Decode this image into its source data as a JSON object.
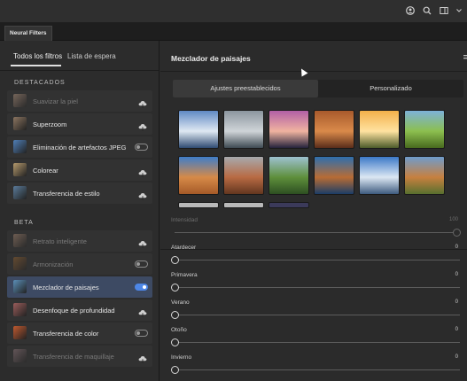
{
  "document_tab": "Neural Filters",
  "left_panel": {
    "tabs": [
      {
        "label": "Todos los filtros"
      },
      {
        "label": "Lista de espera"
      }
    ],
    "sections": [
      {
        "label": "DESTACADOS"
      },
      {
        "label": "BETA"
      }
    ],
    "items": [
      {
        "label": "Suavizar la piel",
        "control": "cloud",
        "dim": true,
        "thumb_color": "#c9a58b"
      },
      {
        "label": "Superzoom",
        "control": "cloud",
        "dim": false,
        "thumb_color": "#8c7560"
      },
      {
        "label": "Eliminación de artefactos JPEG",
        "control": "toggle",
        "toggle_on": false,
        "dim": false,
        "thumb_color": "#4f7fb8"
      },
      {
        "label": "Colorear",
        "control": "cloud",
        "dim": false,
        "thumb_color": "#b59a6d"
      },
      {
        "label": "Transferencia de estilo",
        "control": "cloud",
        "dim": false,
        "thumb_color": "#5a7b9a"
      },
      {
        "label": "Retrato inteligente",
        "control": "cloud",
        "dim": true,
        "thumb_color": "#b89279"
      },
      {
        "label": "Armonización",
        "control": "toggle",
        "toggle_on": false,
        "dim": true,
        "thumb_color": "#a0672f"
      },
      {
        "label": "Mezclador de paisajes",
        "control": "toggle",
        "toggle_on": true,
        "dim": false,
        "selected": true,
        "thumb_color": "#5b8fb8"
      },
      {
        "label": "Desenfoque de profundidad",
        "control": "cloud",
        "dim": false,
        "thumb_color": "#9a5d5b"
      },
      {
        "label": "Transferencia de color",
        "control": "toggle",
        "toggle_on": false,
        "dim": false,
        "thumb_color": "#c0592f"
      },
      {
        "label": "Transferencia de maquillaje",
        "control": "cloud",
        "dim": true,
        "thumb_color": "#9d7f86"
      }
    ]
  },
  "right_panel": {
    "title": "Mezclador de paisajes",
    "segments": [
      {
        "label": "Ajustes preestablecidos",
        "active": true
      },
      {
        "label": "Personalizado",
        "active": false
      }
    ],
    "presets": [
      {
        "name": "snowy-mountain-lake",
        "colors": [
          "#5f89c4",
          "#dfe8f2",
          "#2f4b72"
        ]
      },
      {
        "name": "misty-mountain-road",
        "colors": [
          "#8c969f",
          "#cfd4d8",
          "#3e4a52"
        ]
      },
      {
        "name": "purple-mountain-sunset",
        "colors": [
          "#b25fa6",
          "#f0b3a0",
          "#24223c"
        ]
      },
      {
        "name": "red-canyon",
        "colors": [
          "#a85a2c",
          "#d98a4a",
          "#5a2d1a"
        ]
      },
      {
        "name": "golden-sunset-hills",
        "colors": [
          "#f3b04a",
          "#ffe2a0",
          "#4c5b2a"
        ]
      },
      {
        "name": "green-meadow",
        "colors": [
          "#7db2d9",
          "#8cbf4f",
          "#486a1e"
        ]
      },
      {
        "name": "desert-mesa",
        "colors": [
          "#3f7dc9",
          "#d68a48",
          "#a55a28"
        ]
      },
      {
        "name": "monument-valley",
        "colors": [
          "#a7a9ad",
          "#b86a43",
          "#63361f"
        ]
      },
      {
        "name": "green-river-valley",
        "colors": [
          "#9dc1d0",
          "#5e8f3b",
          "#2d4f22"
        ]
      },
      {
        "name": "lake-reflection",
        "colors": [
          "#2e6fae",
          "#b86c35",
          "#1b3d67"
        ]
      },
      {
        "name": "snowy-peaks-blue",
        "colors": [
          "#3c79c8",
          "#dce7f3",
          "#3d5a7e"
        ]
      },
      {
        "name": "autumn-valley",
        "colors": [
          "#6f9ccc",
          "#c7803f",
          "#58702f"
        ]
      }
    ],
    "sliders": [
      {
        "label": "Intensidad",
        "value_text": "100",
        "value": 1.0,
        "dim": true
      },
      {
        "label": "Atardecer",
        "value_text": "0",
        "value": 0,
        "dim": false
      },
      {
        "label": "Primavera",
        "value_text": "0",
        "value": 0,
        "dim": false
      },
      {
        "label": "Verano",
        "value_text": "0",
        "value": 0,
        "dim": false
      },
      {
        "label": "Otoño",
        "value_text": "0",
        "value": 0,
        "dim": false
      },
      {
        "label": "Invierno",
        "value_text": "0",
        "value": 0,
        "dim": false
      }
    ]
  },
  "toolbar_icons": [
    "account-icon",
    "search-icon",
    "workspace-icon",
    "chevron-down-icon"
  ]
}
